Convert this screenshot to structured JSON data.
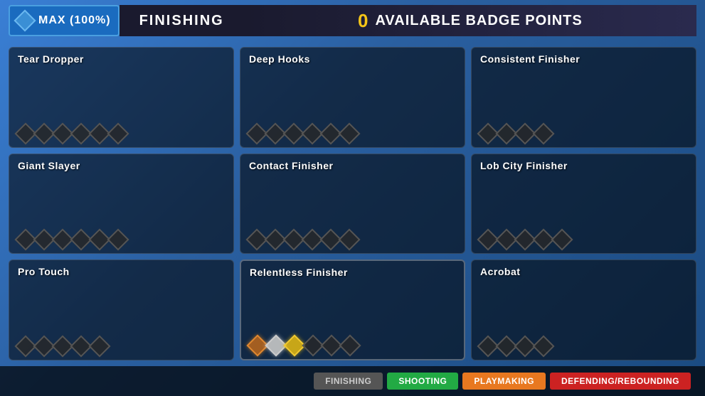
{
  "header": {
    "max_label": "MAX (100%)",
    "finishing_label": "FINISHING",
    "badge_count": "0",
    "badge_points_label": "AVAILABLE BADGE POINTS"
  },
  "badges": [
    {
      "name": "Tear Dropper",
      "diamonds": [
        "empty",
        "empty",
        "empty",
        "empty",
        "empty",
        "empty"
      ],
      "slot": 0
    },
    {
      "name": "Deep Hooks",
      "diamonds": [
        "empty",
        "empty",
        "empty",
        "empty",
        "empty",
        "empty"
      ],
      "slot": 1
    },
    {
      "name": "Consistent Finisher",
      "diamonds": [
        "empty",
        "empty",
        "empty",
        "empty"
      ],
      "slot": 2
    },
    {
      "name": "Giant Slayer",
      "diamonds": [
        "empty",
        "empty",
        "empty",
        "empty",
        "empty",
        "empty"
      ],
      "slot": 3
    },
    {
      "name": "Contact Finisher",
      "diamonds": [
        "empty",
        "empty",
        "empty",
        "empty",
        "empty",
        "empty"
      ],
      "slot": 4
    },
    {
      "name": "Lob City Finisher",
      "diamonds": [
        "empty",
        "empty",
        "empty",
        "empty",
        "empty"
      ],
      "slot": 5
    },
    {
      "name": "Pro Touch",
      "diamonds": [
        "empty",
        "empty",
        "empty",
        "empty",
        "empty"
      ],
      "slot": 6
    },
    {
      "name": "Relentless Finisher",
      "diamonds": [
        "bronze",
        "silver",
        "gold",
        "empty",
        "empty",
        "empty"
      ],
      "slot": 7,
      "active": true
    },
    {
      "name": "Acrobat",
      "diamonds": [
        "empty",
        "empty",
        "empty",
        "empty"
      ],
      "slot": 8
    }
  ],
  "nav_tabs": [
    {
      "label": "FINISHING",
      "style": "finishing"
    },
    {
      "label": "SHOOTING",
      "style": "shooting"
    },
    {
      "label": "PLAYMAKING",
      "style": "playmaking"
    },
    {
      "label": "DEFENDING/REBOUNDING",
      "style": "defending"
    }
  ]
}
